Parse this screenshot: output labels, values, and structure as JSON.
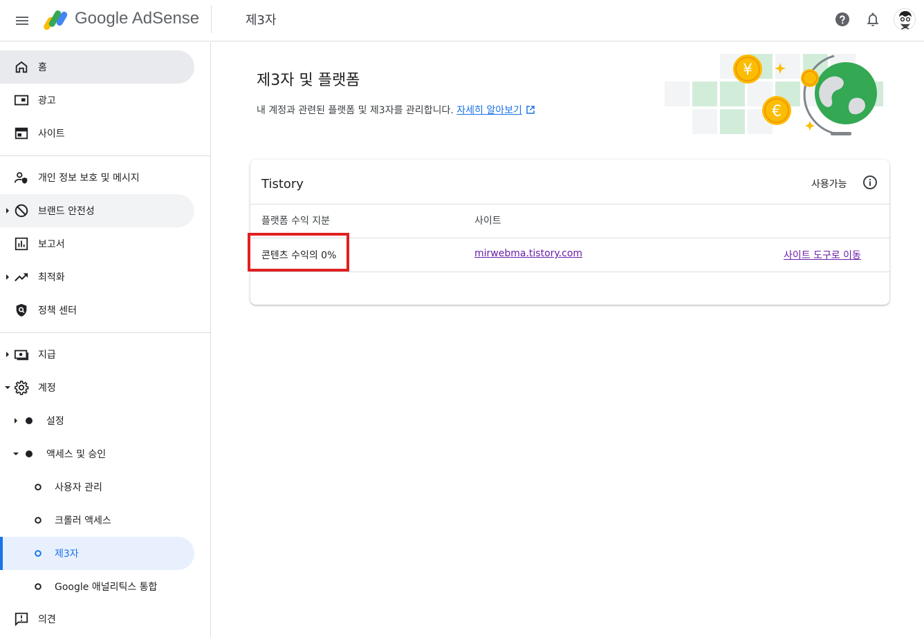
{
  "header": {
    "logo_text": "Google AdSense",
    "page_title": "제3자"
  },
  "sidebar": {
    "items": [
      {
        "label": "홈"
      },
      {
        "label": "광고"
      },
      {
        "label": "사이트"
      },
      {
        "label": "개인 정보 보호 및 메시지"
      },
      {
        "label": "브랜드 안전성"
      },
      {
        "label": "보고서"
      },
      {
        "label": "최적화"
      },
      {
        "label": "정책 센터"
      },
      {
        "label": "지급"
      },
      {
        "label": "계정"
      },
      {
        "label": "설정"
      },
      {
        "label": "액세스 및 승인"
      },
      {
        "label": "사용자 관리"
      },
      {
        "label": "크롤러 액세스"
      },
      {
        "label": "제3자"
      },
      {
        "label": "Google 애널리틱스 통합"
      },
      {
        "label": "의견"
      }
    ]
  },
  "main": {
    "title": "제3자 및 플랫폼",
    "description": "내 계정과 관련된 플랫폼 및 제3자를 관리합니다.",
    "learn_more": "자세히 알아보기"
  },
  "card": {
    "title": "Tistory",
    "status": "사용가능",
    "columns": [
      "플랫폼 수익 지분",
      "사이트"
    ],
    "rows": [
      {
        "share": "콘텐츠 수익의 0%",
        "site": "mirwebma.tistory.com",
        "action": "사이트 도구로 이동"
      }
    ]
  },
  "colors": {
    "accent": "#1a73e8",
    "visited_link": "#681da8",
    "highlight_box": "#e02020",
    "active_nav": "#e8eaed",
    "selected_nav": "#e8f0fe"
  }
}
